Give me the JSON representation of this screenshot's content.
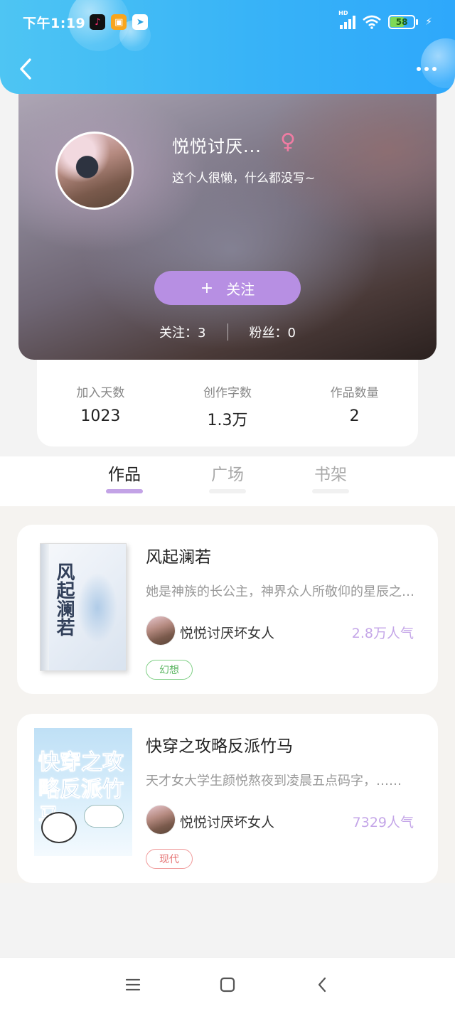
{
  "status_bar": {
    "time": "下午1:19",
    "network_label": "HD",
    "battery_level": "58",
    "battery_fraction": 0.58
  },
  "header": {
    "back_icon": "chevron-left-icon",
    "more_icon": "more-dots-icon",
    "color": "#38b3f7"
  },
  "profile": {
    "name": "悦悦讨厌...",
    "gender_symbol": "♀",
    "bio": "这个人很懒，什么都没写~",
    "follow_plus": "+",
    "follow_label": "关注",
    "following_text": "关注：3",
    "followers_text": "粉丝：0",
    "accent": "#b78fe3"
  },
  "summary": [
    {
      "label": "加入天数",
      "value": "1023"
    },
    {
      "label": "创作字数",
      "value": "1.3万"
    },
    {
      "label": "作品数量",
      "value": "2"
    }
  ],
  "tabs": [
    {
      "label": "作品",
      "active": true
    },
    {
      "label": "广场",
      "active": false
    },
    {
      "label": "书架",
      "active": false
    }
  ],
  "books": [
    {
      "cover_text": "风起澜若",
      "title": "风起澜若",
      "description": "她是神族的长公主，神界众人所敬仰的星辰之主，奈何一朝陨落……",
      "author": "悦悦讨厌坏女人",
      "popularity": "2.8万人气",
      "genre": "幻想",
      "genre_color": "#5fb765"
    },
    {
      "cover_text": "快穿之攻略反派竹马",
      "title": "快穿之攻略反派竹马",
      "description": "天才女大学生颜悦熬夜到凌晨五点码字，……",
      "author": "悦悦讨厌坏女人",
      "popularity": "7329人气",
      "genre": "现代",
      "genre_color": "#e57373"
    }
  ],
  "system_nav": {
    "menu_icon": "menu-lines-icon",
    "home_icon": "home-square-icon",
    "back_icon": "back-triangle-icon"
  }
}
